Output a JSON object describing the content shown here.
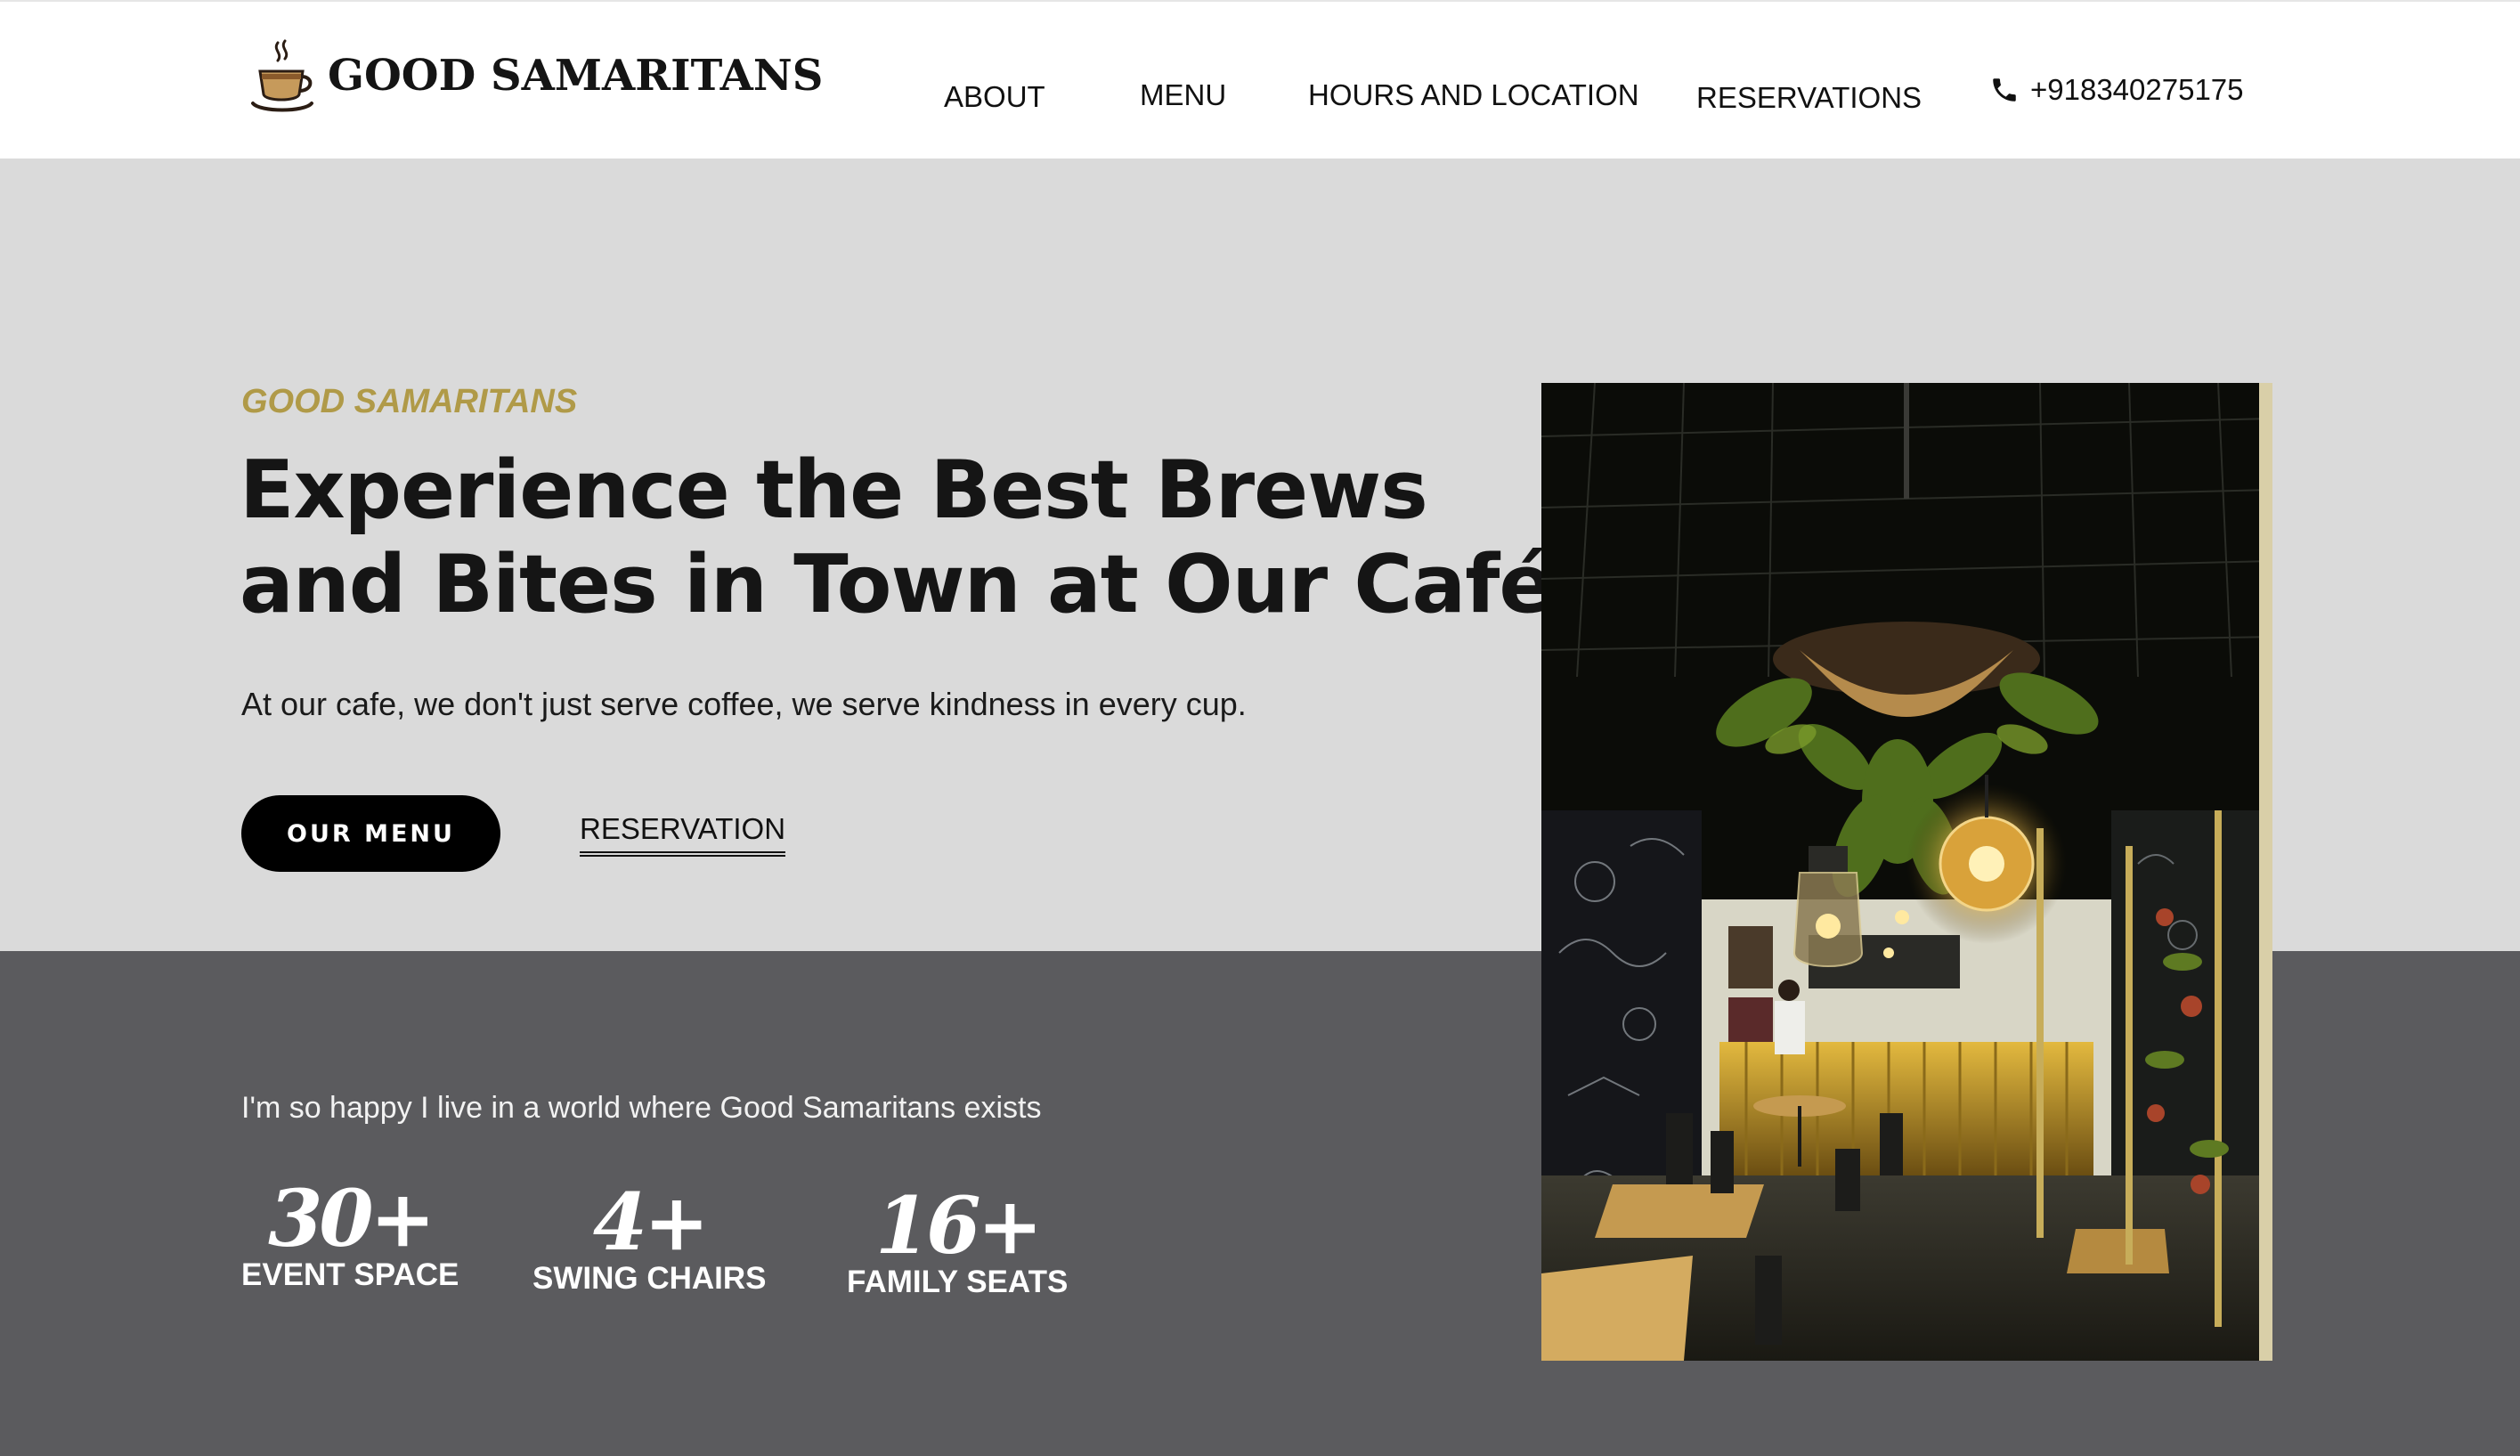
{
  "header": {
    "brand": "GOOD SAMARITANS",
    "logo_icon": "coffee-cup-icon",
    "nav": [
      "ABOUT",
      "MENU",
      "HOURS AND LOCATION",
      "RESERVATIONS"
    ],
    "phone_icon": "phone-icon",
    "phone": "+918340275175"
  },
  "hero": {
    "eyebrow": "GOOD SAMARITANS",
    "headline_line1": "Experience the Best Brews",
    "headline_line2": "and Bites in Town at Our Café",
    "subtext": "At our cafe, we don't just serve coffee, we serve kindness in every cup.",
    "primary_button": "OUR MENU",
    "secondary_link": "RESERVATION"
  },
  "stats": {
    "quote": "I'm so happy I live in a world where Good Samaritans exists",
    "items": [
      {
        "value": "30+",
        "label": "EVENT SPACE"
      },
      {
        "value": "4+",
        "label": "SWING CHAIRS"
      },
      {
        "value": "16+",
        "label": "FAMILY SEATS"
      }
    ]
  },
  "colors": {
    "accent": "#b09a48",
    "hero_bg": "#dadada",
    "band_bg": "#5b5b5e",
    "button_bg": "#000000"
  }
}
